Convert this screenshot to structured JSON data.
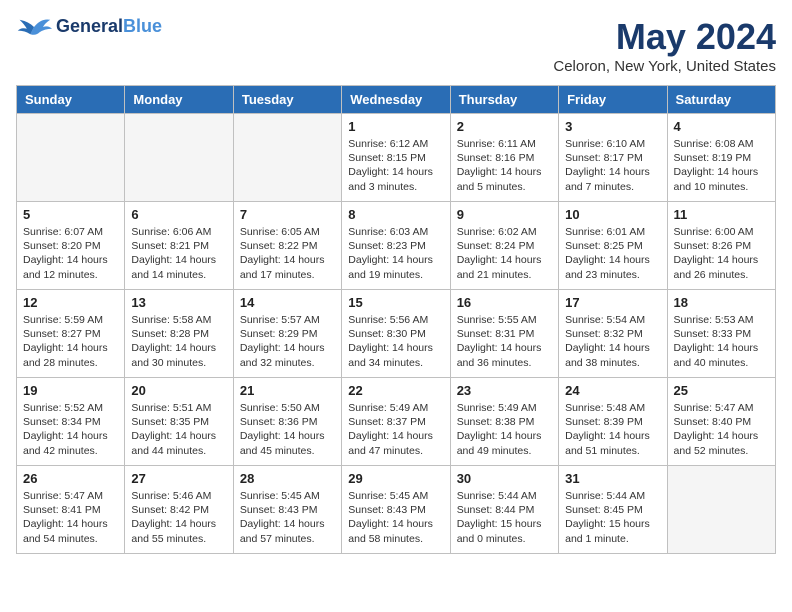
{
  "header": {
    "logo_general": "General",
    "logo_blue": "Blue",
    "month_title": "May 2024",
    "location": "Celoron, New York, United States"
  },
  "weekdays": [
    "Sunday",
    "Monday",
    "Tuesday",
    "Wednesday",
    "Thursday",
    "Friday",
    "Saturday"
  ],
  "weeks": [
    [
      {
        "day": "",
        "text": ""
      },
      {
        "day": "",
        "text": ""
      },
      {
        "day": "",
        "text": ""
      },
      {
        "day": "1",
        "text": "Sunrise: 6:12 AM\nSunset: 8:15 PM\nDaylight: 14 hours and 3 minutes."
      },
      {
        "day": "2",
        "text": "Sunrise: 6:11 AM\nSunset: 8:16 PM\nDaylight: 14 hours and 5 minutes."
      },
      {
        "day": "3",
        "text": "Sunrise: 6:10 AM\nSunset: 8:17 PM\nDaylight: 14 hours and 7 minutes."
      },
      {
        "day": "4",
        "text": "Sunrise: 6:08 AM\nSunset: 8:19 PM\nDaylight: 14 hours and 10 minutes."
      }
    ],
    [
      {
        "day": "5",
        "text": "Sunrise: 6:07 AM\nSunset: 8:20 PM\nDaylight: 14 hours and 12 minutes."
      },
      {
        "day": "6",
        "text": "Sunrise: 6:06 AM\nSunset: 8:21 PM\nDaylight: 14 hours and 14 minutes."
      },
      {
        "day": "7",
        "text": "Sunrise: 6:05 AM\nSunset: 8:22 PM\nDaylight: 14 hours and 17 minutes."
      },
      {
        "day": "8",
        "text": "Sunrise: 6:03 AM\nSunset: 8:23 PM\nDaylight: 14 hours and 19 minutes."
      },
      {
        "day": "9",
        "text": "Sunrise: 6:02 AM\nSunset: 8:24 PM\nDaylight: 14 hours and 21 minutes."
      },
      {
        "day": "10",
        "text": "Sunrise: 6:01 AM\nSunset: 8:25 PM\nDaylight: 14 hours and 23 minutes."
      },
      {
        "day": "11",
        "text": "Sunrise: 6:00 AM\nSunset: 8:26 PM\nDaylight: 14 hours and 26 minutes."
      }
    ],
    [
      {
        "day": "12",
        "text": "Sunrise: 5:59 AM\nSunset: 8:27 PM\nDaylight: 14 hours and 28 minutes."
      },
      {
        "day": "13",
        "text": "Sunrise: 5:58 AM\nSunset: 8:28 PM\nDaylight: 14 hours and 30 minutes."
      },
      {
        "day": "14",
        "text": "Sunrise: 5:57 AM\nSunset: 8:29 PM\nDaylight: 14 hours and 32 minutes."
      },
      {
        "day": "15",
        "text": "Sunrise: 5:56 AM\nSunset: 8:30 PM\nDaylight: 14 hours and 34 minutes."
      },
      {
        "day": "16",
        "text": "Sunrise: 5:55 AM\nSunset: 8:31 PM\nDaylight: 14 hours and 36 minutes."
      },
      {
        "day": "17",
        "text": "Sunrise: 5:54 AM\nSunset: 8:32 PM\nDaylight: 14 hours and 38 minutes."
      },
      {
        "day": "18",
        "text": "Sunrise: 5:53 AM\nSunset: 8:33 PM\nDaylight: 14 hours and 40 minutes."
      }
    ],
    [
      {
        "day": "19",
        "text": "Sunrise: 5:52 AM\nSunset: 8:34 PM\nDaylight: 14 hours and 42 minutes."
      },
      {
        "day": "20",
        "text": "Sunrise: 5:51 AM\nSunset: 8:35 PM\nDaylight: 14 hours and 44 minutes."
      },
      {
        "day": "21",
        "text": "Sunrise: 5:50 AM\nSunset: 8:36 PM\nDaylight: 14 hours and 45 minutes."
      },
      {
        "day": "22",
        "text": "Sunrise: 5:49 AM\nSunset: 8:37 PM\nDaylight: 14 hours and 47 minutes."
      },
      {
        "day": "23",
        "text": "Sunrise: 5:49 AM\nSunset: 8:38 PM\nDaylight: 14 hours and 49 minutes."
      },
      {
        "day": "24",
        "text": "Sunrise: 5:48 AM\nSunset: 8:39 PM\nDaylight: 14 hours and 51 minutes."
      },
      {
        "day": "25",
        "text": "Sunrise: 5:47 AM\nSunset: 8:40 PM\nDaylight: 14 hours and 52 minutes."
      }
    ],
    [
      {
        "day": "26",
        "text": "Sunrise: 5:47 AM\nSunset: 8:41 PM\nDaylight: 14 hours and 54 minutes."
      },
      {
        "day": "27",
        "text": "Sunrise: 5:46 AM\nSunset: 8:42 PM\nDaylight: 14 hours and 55 minutes."
      },
      {
        "day": "28",
        "text": "Sunrise: 5:45 AM\nSunset: 8:43 PM\nDaylight: 14 hours and 57 minutes."
      },
      {
        "day": "29",
        "text": "Sunrise: 5:45 AM\nSunset: 8:43 PM\nDaylight: 14 hours and 58 minutes."
      },
      {
        "day": "30",
        "text": "Sunrise: 5:44 AM\nSunset: 8:44 PM\nDaylight: 15 hours and 0 minutes."
      },
      {
        "day": "31",
        "text": "Sunrise: 5:44 AM\nSunset: 8:45 PM\nDaylight: 15 hours and 1 minute."
      },
      {
        "day": "",
        "text": ""
      }
    ]
  ]
}
